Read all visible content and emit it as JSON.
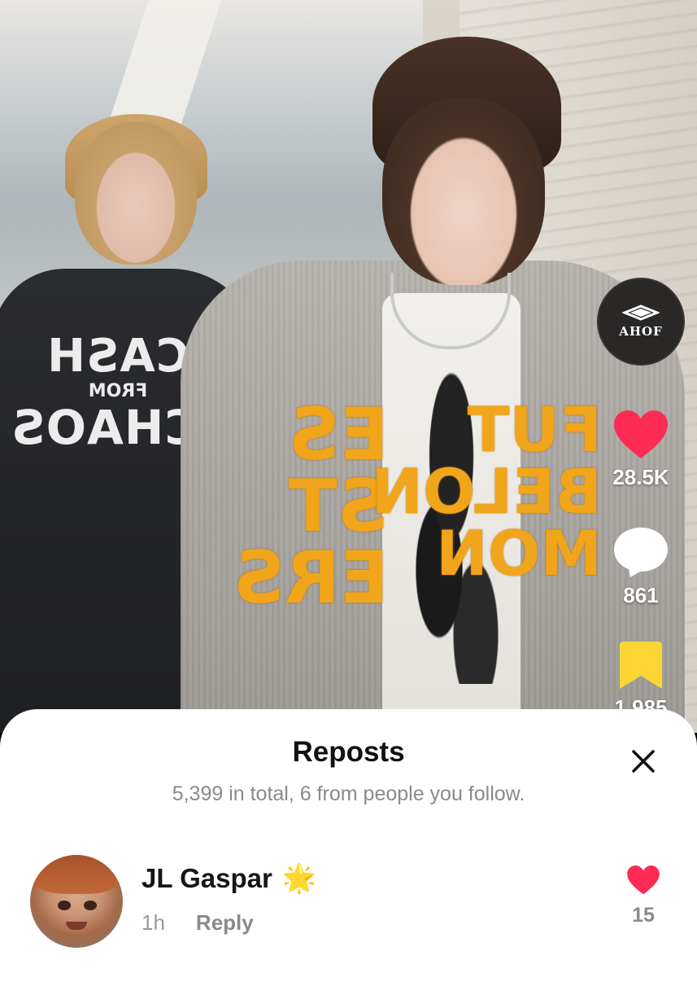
{
  "video": {
    "creator_badge": {
      "label": "AHOF"
    },
    "actions": {
      "like_count": "28.5K",
      "comment_count": "861",
      "save_count": "1,985"
    },
    "colors": {
      "like": "#fe2c55",
      "save": "#fcd535"
    },
    "shirt_text": {
      "left": {
        "l1": "CASH",
        "l2": "FROM",
        "l3": "CHAOS"
      },
      "right_a": "ES\nST\nERS",
      "right_b": "FUT\nBELON\nMON"
    }
  },
  "sheet": {
    "title": "Reposts",
    "subtitle": "5,399 in total, 6 from people you follow.",
    "close_icon": "close-icon",
    "comments": [
      {
        "name": "JL Gaspar",
        "badge": "🌟",
        "time": "1h",
        "reply_label": "Reply",
        "like_count": "15"
      }
    ]
  }
}
